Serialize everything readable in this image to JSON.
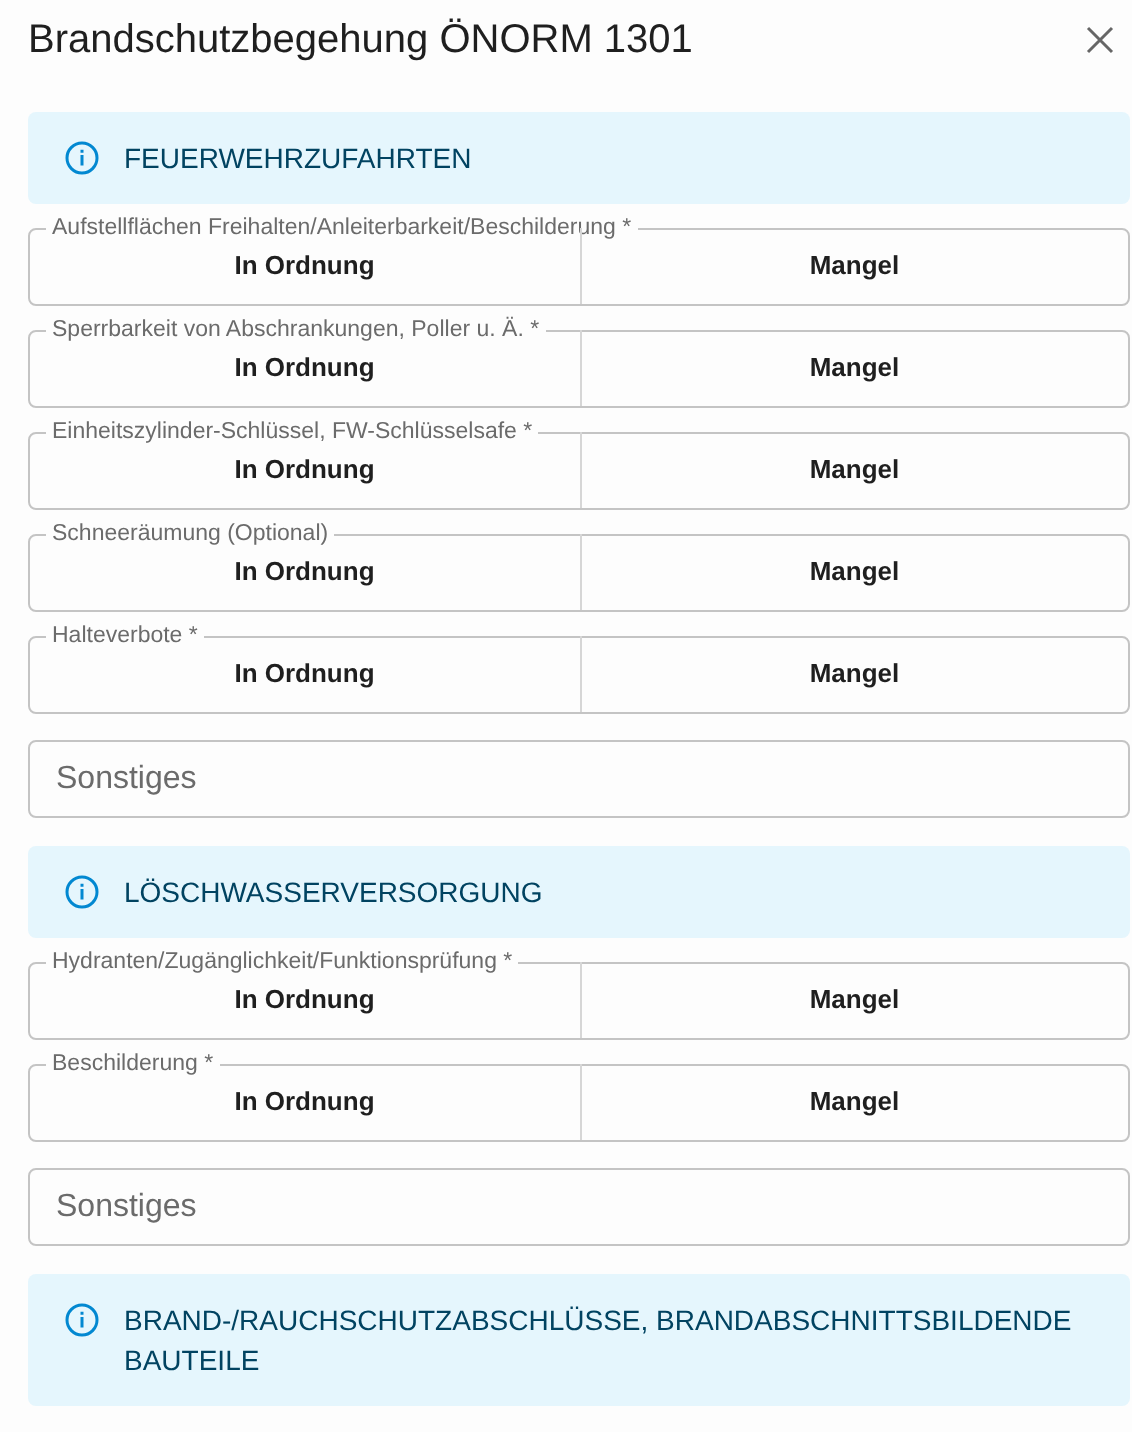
{
  "dialog": {
    "title": "Brandschutzbegehung ÖNORM 1301"
  },
  "sections": [
    {
      "title": "FEUERWEHRZUFAHRTEN",
      "items": [
        {
          "kind": "toggle",
          "label": "Aufstellflächen Freihalten/Anleiterbarkeit/Beschilderung *",
          "options": [
            {
              "label": "In Ordnung",
              "selected": false
            },
            {
              "label": "Mangel",
              "selected": false
            }
          ]
        },
        {
          "kind": "toggle",
          "label": "Sperrbarkeit von Abschrankungen, Poller u. Ä. *",
          "options": [
            {
              "label": "In Ordnung",
              "selected": false
            },
            {
              "label": "Mangel",
              "selected": false
            }
          ]
        },
        {
          "kind": "toggle",
          "label": "Einheitszylinder-Schlüssel, FW-Schlüsselsafe *",
          "options": [
            {
              "label": "In Ordnung",
              "selected": false
            },
            {
              "label": "Mangel",
              "selected": false
            }
          ]
        },
        {
          "kind": "toggle",
          "label": "Schneeräumung (Optional)",
          "options": [
            {
              "label": "In Ordnung",
              "selected": false
            },
            {
              "label": "Mangel",
              "selected": false
            }
          ]
        },
        {
          "kind": "toggle",
          "label": "Halteverbote *",
          "options": [
            {
              "label": "In Ordnung",
              "selected": false
            },
            {
              "label": "Mangel",
              "selected": false
            }
          ]
        },
        {
          "kind": "text",
          "placeholder": "Sonstiges"
        }
      ]
    },
    {
      "title": "LÖSCHWASSERVERSORGUNG",
      "items": [
        {
          "kind": "toggle",
          "label": "Hydranten/Zugänglichkeit/Funktionsprüfung *",
          "options": [
            {
              "label": "In Ordnung",
              "selected": false
            },
            {
              "label": "Mangel",
              "selected": false
            }
          ]
        },
        {
          "kind": "toggle",
          "label": "Beschilderung *",
          "options": [
            {
              "label": "In Ordnung",
              "selected": false
            },
            {
              "label": "Mangel",
              "selected": false
            }
          ]
        },
        {
          "kind": "text",
          "placeholder": "Sonstiges"
        }
      ]
    },
    {
      "title": "BRAND-/RAUCHSCHUTZABSCHLÜSSE, BRANDABSCHNITTSBILDENDE BAUTEILE"
    }
  ]
}
